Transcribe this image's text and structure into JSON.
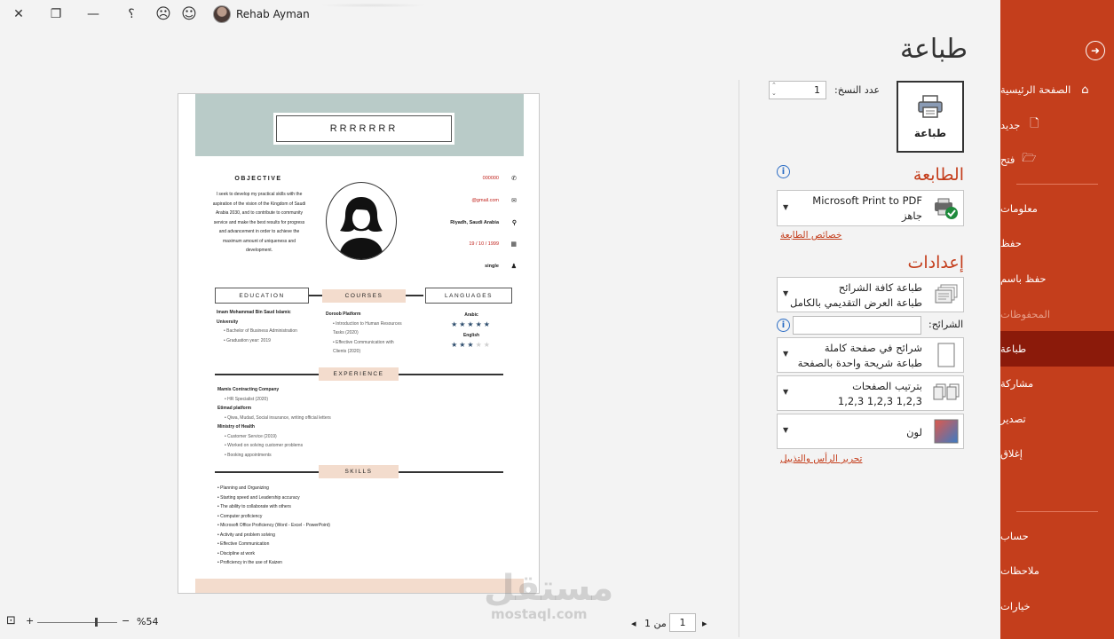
{
  "titlebar": {
    "user_name": "Rehab Ayman",
    "help": "؟",
    "buttons": [
      "close-icon",
      "restore-icon",
      "minimize-icon",
      "help-icon",
      "frown-icon",
      "smile-icon"
    ]
  },
  "sidebar": {
    "items": [
      {
        "label": "الصفحة الرئيسية",
        "icon": "home-icon"
      },
      {
        "label": "جديد",
        "icon": "new-file-icon"
      },
      {
        "label": "فتح",
        "icon": "open-folder-icon"
      },
      {
        "label": "معلومات"
      },
      {
        "label": "حفظ"
      },
      {
        "label": "حفظ باسم"
      },
      {
        "label": "المحفوظات"
      },
      {
        "label": "طباعة"
      },
      {
        "label": "مشاركة"
      },
      {
        "label": "تصدير"
      },
      {
        "label": "إغلاق"
      },
      {
        "label": "حساب"
      },
      {
        "label": "ملاحظات"
      },
      {
        "label": "خيارات"
      }
    ],
    "active": "طباعة",
    "accent": "#c43e1c",
    "active_color": "#8b1a0a"
  },
  "print": {
    "title": "طباعة",
    "button_label": "طباعة",
    "copies_label": "عدد النسخ:",
    "copies_value": "1",
    "printer_heading": "الطابعة",
    "printer_name": "Microsoft Print to PDF",
    "printer_status": "جاهز",
    "printer_properties": "خصائص الطابعة",
    "settings_heading": "إعدادات",
    "slides_range_title": "طباعة كافة الشرائح",
    "slides_range_desc": "طباعة العرض التقديمي بالكامل",
    "slides_label": "الشرائح:",
    "slides_value": "",
    "layout_title": "شرائح في صفحة كاملة",
    "layout_desc": "طباعة شريحة واحدة بالصفحة",
    "collate_title": "بترتيب الصفحات",
    "collate_desc": "1,2,3    1,2,3    1,2,3",
    "color_title": "لون",
    "header_footer_link": "تحرير الرأس والتذييل"
  },
  "preview": {
    "name": "RRRRRRR",
    "objective_title": "OBJECTIVE",
    "objective_text": "I seek to develop my practical skills with the aspiration of the vision of the Kingdom of Saudi Arabia 2030, and to contribute to community service and make the best results for progress and advancement in order to achieve the maximum amount of uniqueness and development.",
    "phone": "000000",
    "email": "@gmail.com",
    "location": "Riyadh, Saudi Arabia",
    "birth": "19 / 10 / 1999",
    "status": "single",
    "education_title": "EDUCATION",
    "courses_title": "COURSES",
    "languages_title": "LANGUAGES",
    "education": {
      "school": "Imam Mohammad Bin Saud Islamic University",
      "items": [
        "Bachelor of Business Administration",
        "Graduation year: 2019"
      ]
    },
    "courses": {
      "provider": "Doroob Platform",
      "items": [
        "Introduction to Human Resources Tasks (2020)",
        "Effective Communication with Clients (2020)"
      ]
    },
    "languages": [
      {
        "name": "Arabic",
        "stars": 5
      },
      {
        "name": "English",
        "stars": 3
      }
    ],
    "experience_title": "EXPERIENCE",
    "experience": [
      {
        "org": "Mamis Contracting Company",
        "items": [
          "HR Specialist (2020)"
        ]
      },
      {
        "org": "Etimad platform",
        "items": [
          "Qiwa, Mudad, Social insurance, writing official letters"
        ]
      },
      {
        "org": "Ministry of Health",
        "items": [
          "Customer Service (2019)",
          "Worked on solving customer problems",
          "Booking appointments"
        ]
      }
    ],
    "skills_title": "SKILLS",
    "skills": [
      "Planning and Organizing",
      "Starting speed and Leadership accuracy",
      "The ability to collaborate with others",
      "Computer proficiency",
      "Microsoft Office Proficiency (Word - Excel - PowerPoint)",
      "Activity and problem solving",
      "Effective Communication",
      "Discipline at work",
      "Proficiency in the use of Kaizen"
    ]
  },
  "pager": {
    "current": "1",
    "of_label": "من 1"
  },
  "zoom": {
    "value": "%54",
    "minus": "−",
    "plus": "+"
  },
  "watermark": {
    "arabic": "مستقل",
    "latin": "mostaql.com"
  }
}
